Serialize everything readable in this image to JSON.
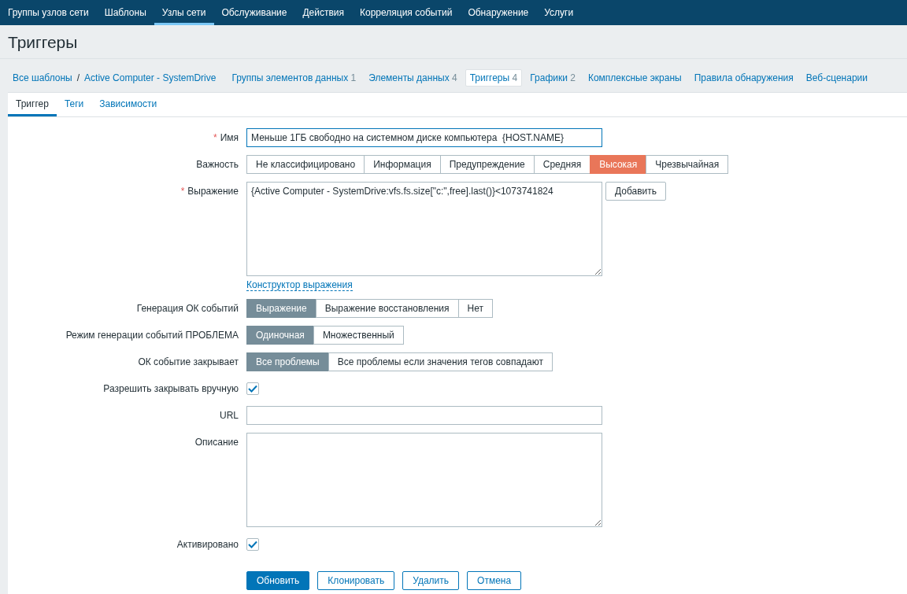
{
  "top_nav": [
    {
      "label": "Группы узлов сети",
      "selected": false
    },
    {
      "label": "Шаблоны",
      "selected": false
    },
    {
      "label": "Узлы сети",
      "selected": true
    },
    {
      "label": "Обслуживание",
      "selected": false
    },
    {
      "label": "Действия",
      "selected": false
    },
    {
      "label": "Корреляция событий",
      "selected": false
    },
    {
      "label": "Обнаружение",
      "selected": false
    },
    {
      "label": "Услуги",
      "selected": false
    }
  ],
  "page_title": "Триггеры",
  "breadcrumbs": {
    "items": [
      "Все шаблоны",
      "Active Computer - SystemDrive"
    ],
    "separator": "/"
  },
  "nav_tabs": [
    {
      "label": "Группы элементов данных",
      "count": "1",
      "selected": false
    },
    {
      "label": "Элементы данных",
      "count": "4",
      "selected": false
    },
    {
      "label": "Триггеры",
      "count": "4",
      "selected": true
    },
    {
      "label": "Графики",
      "count": "2",
      "selected": false
    },
    {
      "label": "Комплексные экраны",
      "selected": false
    },
    {
      "label": "Правила обнаружения",
      "selected": false
    },
    {
      "label": "Веб-сценарии",
      "selected": false
    }
  ],
  "sub_tabs": [
    {
      "label": "Триггер",
      "selected": true
    },
    {
      "label": "Теги",
      "selected": false
    },
    {
      "label": "Зависимости",
      "selected": false
    }
  ],
  "form": {
    "name": {
      "label": "Имя",
      "required_mark": "*",
      "value": "Меньше 1ГБ свободно на системном диске компьютера  {HOST.NAME}"
    },
    "severity": {
      "label": "Важность",
      "kind": "severity",
      "options": [
        {
          "label": "Не классифицировано",
          "selected": false
        },
        {
          "label": "Информация",
          "selected": false
        },
        {
          "label": "Предупреждение",
          "selected": false
        },
        {
          "label": "Средняя",
          "selected": false
        },
        {
          "label": "Высокая",
          "selected": true
        },
        {
          "label": "Чрезвычайная",
          "selected": false
        }
      ]
    },
    "expression": {
      "label": "Выражение",
      "required_mark": "*",
      "value": "{Active Computer - SystemDrive:vfs.fs.size[\"c:\",free].last()}<1073741824",
      "add_button": "Добавить",
      "constructor_link": "Конструктор выражения"
    },
    "ok_event_generation": {
      "label": "Генерация ОК событий",
      "kind": "radio",
      "options": [
        {
          "label": "Выражение",
          "selected": true
        },
        {
          "label": "Выражение восстановления",
          "selected": false
        },
        {
          "label": "Нет",
          "selected": false
        }
      ]
    },
    "problem_mode": {
      "label": "Режим генерации событий ПРОБЛЕМА",
      "kind": "radio",
      "options": [
        {
          "label": "Одиночная",
          "selected": true
        },
        {
          "label": "Множественный",
          "selected": false
        }
      ]
    },
    "ok_closes": {
      "label": "ОК событие закрывает",
      "kind": "radio",
      "options": [
        {
          "label": "Все проблемы",
          "selected": true
        },
        {
          "label": "Все проблемы если значения тегов совпадают",
          "selected": false
        }
      ]
    },
    "allow_manual_close": {
      "label": "Разрешить закрывать вручную",
      "checked": true
    },
    "url": {
      "label": "URL"
    },
    "description": {
      "label": "Описание"
    },
    "enabled": {
      "label": "Активировано",
      "checked": true
    },
    "buttons": [
      {
        "label": "Обновить",
        "kind": "primary"
      },
      {
        "label": "Клонировать",
        "kind": "secondary"
      },
      {
        "label": "Удалить",
        "kind": "secondary"
      },
      {
        "label": "Отмена",
        "kind": "secondary"
      }
    ]
  }
}
